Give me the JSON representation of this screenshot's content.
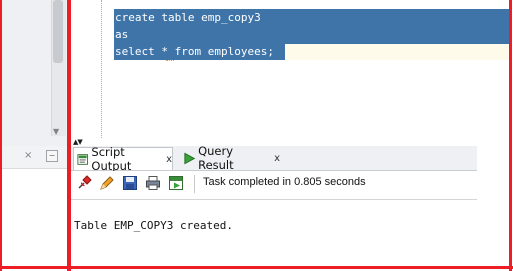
{
  "editor": {
    "lines": [
      "create table emp_copy3",
      "as",
      "select * from employees;"
    ]
  },
  "output_panel": {
    "tabs": [
      {
        "label": "Script Output",
        "close": "x"
      },
      {
        "label": "Query Result",
        "close": "x"
      }
    ],
    "status": "Task completed in 0.805 seconds",
    "result_text": "Table EMP_COPY3 created."
  },
  "left_panel": {
    "close": "×",
    "minimize": "−"
  },
  "icons": {
    "pin": "pin-icon",
    "edit": "pencil-icon",
    "save": "save-icon",
    "print": "print-icon",
    "run_script": "run-script-icon"
  },
  "colors": {
    "selection": "#3f74a9",
    "highlight_frame": "#ee1c24",
    "current_line": "#fffbea"
  }
}
